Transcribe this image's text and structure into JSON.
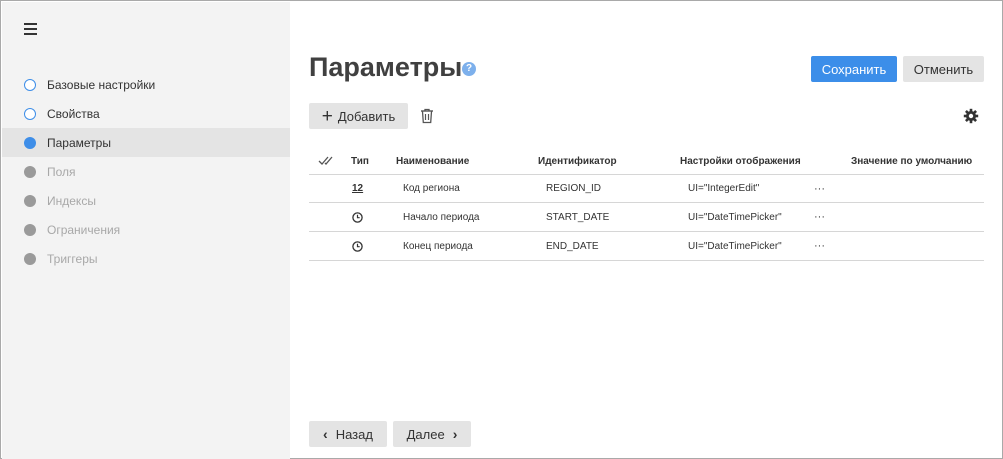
{
  "sidebar": {
    "items": [
      {
        "label": "Базовые настройки",
        "state": "done"
      },
      {
        "label": "Свойства",
        "state": "done"
      },
      {
        "label": "Параметры",
        "state": "current"
      },
      {
        "label": "Поля",
        "state": "pending"
      },
      {
        "label": "Индексы",
        "state": "pending"
      },
      {
        "label": "Ограничения",
        "state": "pending"
      },
      {
        "label": "Триггеры",
        "state": "pending"
      }
    ]
  },
  "header": {
    "title": "Параметры",
    "help_label": "?",
    "save_label": "Сохранить",
    "cancel_label": "Отменить"
  },
  "toolbar": {
    "add_label": "Добавить",
    "add_icon": "+"
  },
  "table": {
    "columns": {
      "check": "✓✓",
      "type": "Тип",
      "name": "Наименование",
      "id": "Идентификатор",
      "settings": "Настройки отображения",
      "default": "Значение по умолчанию"
    },
    "rows": [
      {
        "type_icon": "integer-icon",
        "type_text": "12",
        "name": "Код региона",
        "id": "REGION_ID",
        "settings": "UI=\"IntegerEdit\"",
        "more": "···"
      },
      {
        "type_icon": "clock-icon",
        "type_text": "",
        "name": "Начало периода",
        "id": "START_DATE",
        "settings": "UI=\"DateTimePicker\"",
        "more": "···"
      },
      {
        "type_icon": "clock-icon",
        "type_text": "",
        "name": "Конец периода",
        "id": "END_DATE",
        "settings": "UI=\"DateTimePicker\"",
        "more": "···"
      }
    ]
  },
  "footer": {
    "back_label": "Назад",
    "next_label": "Далее"
  },
  "colors": {
    "accent": "#3c8ee9",
    "sidebar_bg": "#f3f3f3",
    "button_bg": "#e4e4e4"
  }
}
